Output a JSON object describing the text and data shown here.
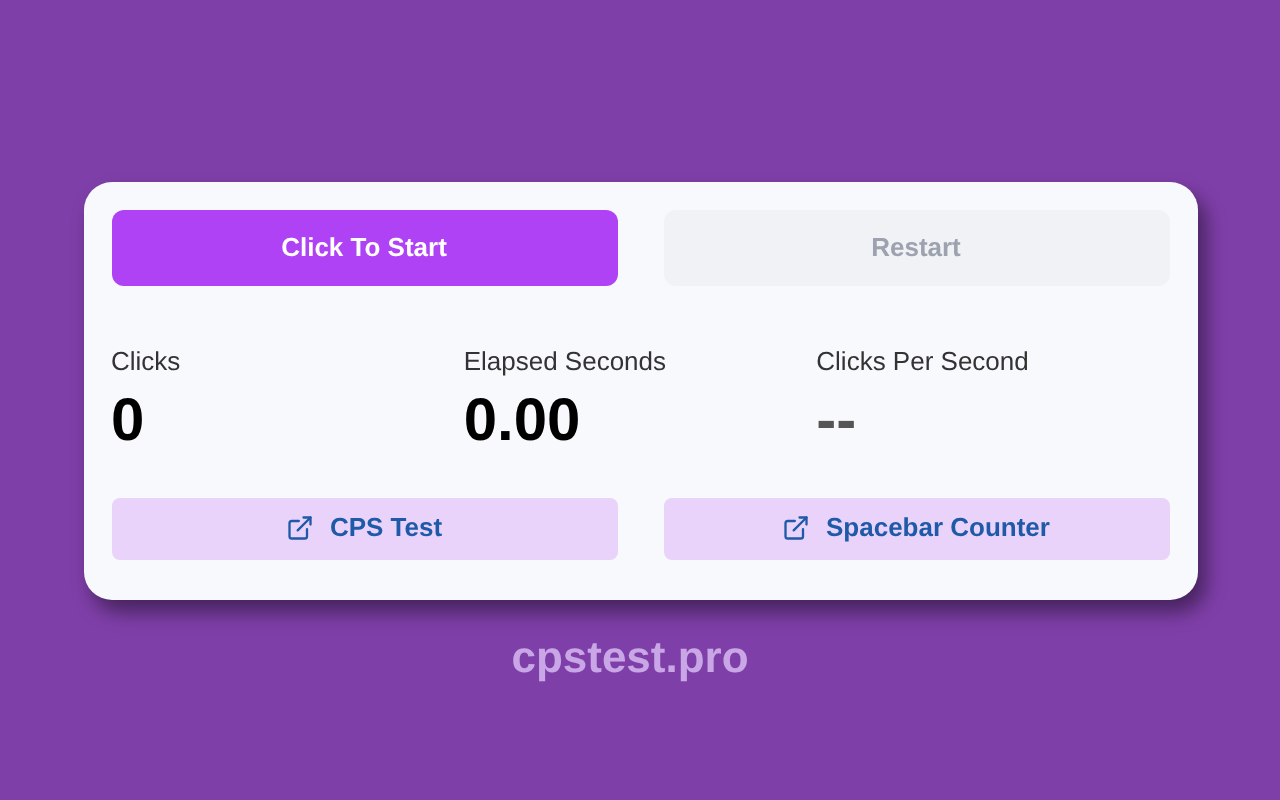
{
  "controls": [
    {
      "label": "Click To Start",
      "disabled": false
    },
    {
      "label": "Restart",
      "disabled": true
    }
  ],
  "stats": [
    {
      "label": "Clicks",
      "value": "0",
      "empty": false
    },
    {
      "label": "Elapsed Seconds",
      "value": "0.00",
      "empty": false
    },
    {
      "label": "Clicks Per Second",
      "value": "--",
      "empty": true
    }
  ],
  "links": [
    {
      "label": "CPS Test"
    },
    {
      "label": "Spacebar Counter"
    }
  ],
  "site": "cpstest.pro"
}
